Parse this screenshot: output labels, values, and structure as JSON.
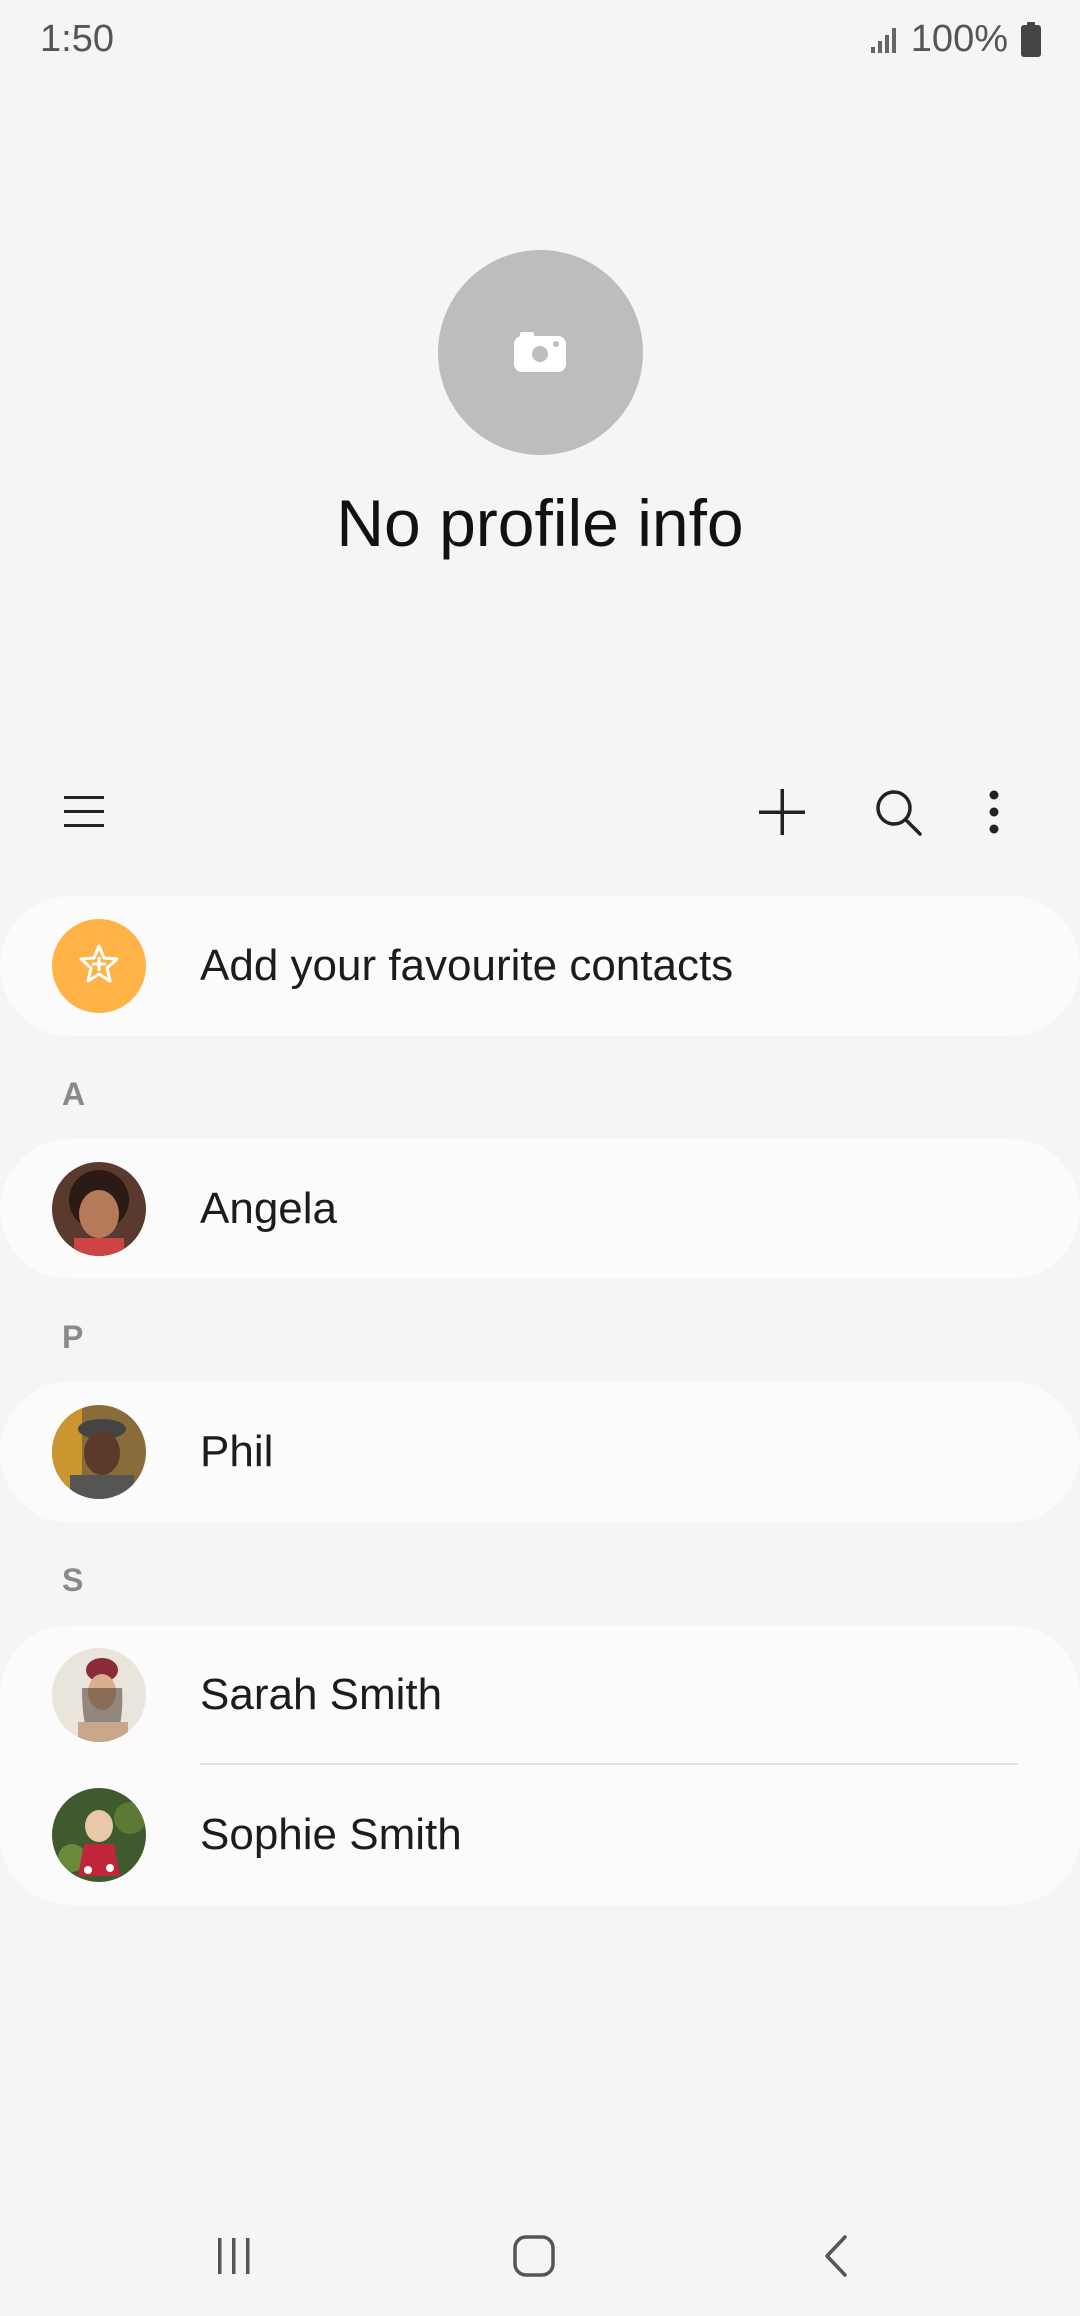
{
  "status_bar": {
    "time": "1:50",
    "battery": "100%"
  },
  "profile": {
    "title": "No profile info"
  },
  "favourites": {
    "label": "Add your favourite contacts"
  },
  "sections": [
    {
      "letter": "A",
      "contacts": [
        "Angela"
      ]
    },
    {
      "letter": "P",
      "contacts": [
        "Phil"
      ]
    },
    {
      "letter": "S",
      "contacts": [
        "Sarah Smith",
        "Sophie Smith"
      ]
    }
  ],
  "colors": {
    "background": "#f5f5f5",
    "card": "#fbfbfb",
    "favourite_accent": "#ffb347",
    "avatar_placeholder": "#bdbdbd"
  },
  "icons": [
    "menu-icon",
    "add-icon",
    "search-icon",
    "more-options-icon",
    "camera-icon",
    "star-icon",
    "recents-icon",
    "home-icon",
    "back-icon"
  ]
}
